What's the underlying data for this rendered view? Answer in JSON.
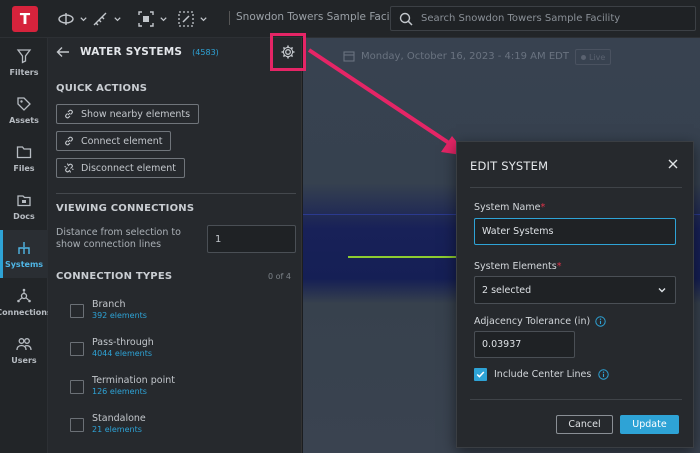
{
  "app": {
    "logo_letter": "T",
    "project_name": "Snowdon Towers Sample Facility"
  },
  "search": {
    "placeholder": "Search Snowdon Towers Sample Facility"
  },
  "toolbar": {
    "tools": [
      {
        "icon": "orbit-icon"
      },
      {
        "icon": "measure-icon"
      },
      {
        "icon": "section-box-icon"
      },
      {
        "icon": "markup-icon"
      }
    ]
  },
  "rail": {
    "items": [
      {
        "label": "Filters",
        "icon": "filter-icon"
      },
      {
        "label": "Assets",
        "icon": "tag-icon"
      },
      {
        "label": "Files",
        "icon": "folder-icon"
      },
      {
        "label": "Docs",
        "icon": "docs-icon"
      },
      {
        "label": "Systems",
        "icon": "systems-icon",
        "active": true
      },
      {
        "label": "Connections",
        "icon": "connections-icon"
      },
      {
        "label": "Users",
        "icon": "users-icon"
      }
    ]
  },
  "panel": {
    "title": "WATER SYSTEMS",
    "count": "(4583)",
    "quick_actions_title": "QUICK ACTIONS",
    "actions": [
      {
        "label": "Show nearby elements",
        "icon": "link-icon"
      },
      {
        "label": "Connect element",
        "icon": "link-icon"
      },
      {
        "label": "Disconnect element",
        "icon": "unlink-icon"
      }
    ],
    "viewing_title": "VIEWING CONNECTIONS",
    "distance_label": "Distance from selection to show connection lines",
    "distance_value": "1",
    "conn_types_title": "CONNECTION TYPES",
    "conn_types_count": "0 of 4",
    "connection_types": [
      {
        "name": "Branch",
        "count": "392 elements"
      },
      {
        "name": "Pass-through",
        "count": "4044 elements"
      },
      {
        "name": "Termination point",
        "count": "126 elements"
      },
      {
        "name": "Standalone",
        "count": "21 elements"
      }
    ]
  },
  "viewport": {
    "date": "Monday, October 16, 2023 - 4:19 AM EDT",
    "live_label": "Live"
  },
  "dialog": {
    "title": "EDIT SYSTEM",
    "name_label": "System Name",
    "name_value": "Water Systems",
    "elements_label": "System Elements",
    "elements_value": "2 selected",
    "tolerance_label": "Adjacency Tolerance (in)",
    "tolerance_value": "0.03937",
    "center_lines_label": "Include Center Lines",
    "center_lines_checked": true,
    "cancel_label": "Cancel",
    "update_label": "Update",
    "required_mark": "*"
  },
  "colors": {
    "accent": "#2ea3d6",
    "annotation": "#e52566",
    "logo": "#d6233c",
    "required": "#e0334a"
  }
}
